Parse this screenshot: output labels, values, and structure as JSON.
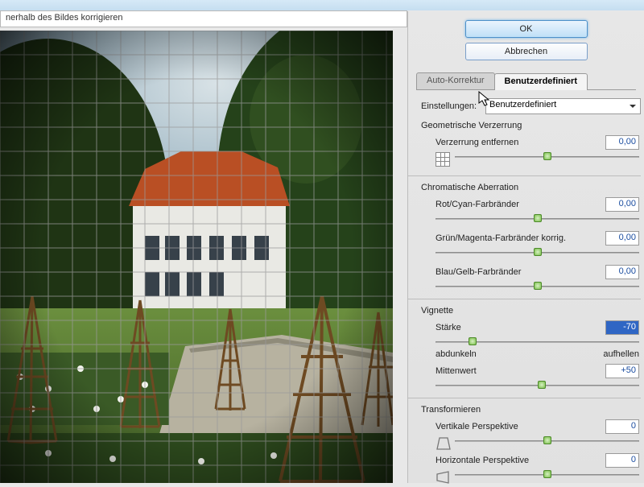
{
  "dialog": {
    "title_fragment": "nerhalb des Bildes korrigieren"
  },
  "buttons": {
    "ok": "OK",
    "cancel": "Abbrechen"
  },
  "tabs": {
    "auto": "Auto-Korrektur",
    "custom": "Benutzerdefiniert"
  },
  "settings": {
    "label": "Einstellungen:",
    "value": "Benutzerdefiniert"
  },
  "sections": {
    "distortion": {
      "title": "Geometrische Verzerrung",
      "remove": {
        "label": "Verzerrung entfernen",
        "value": "0,00",
        "pos": 50
      }
    },
    "chroma": {
      "title": "Chromatische Aberration",
      "red": {
        "label": "Rot/Cyan-Farbränder",
        "value": "0,00",
        "pos": 50
      },
      "green": {
        "label": "Grün/Magenta-Farbränder korrig.",
        "value": "0,00",
        "pos": 50
      },
      "blue": {
        "label": "Blau/Gelb-Farbränder",
        "value": "0,00",
        "pos": 50
      }
    },
    "vignette": {
      "title": "Vignette",
      "amount": {
        "label": "Stärke",
        "value": "-70",
        "pos": 18,
        "left": "abdunkeln",
        "right": "aufhellen"
      },
      "mid": {
        "label": "Mittenwert",
        "value": "+50",
        "pos": 52
      }
    },
    "transform": {
      "title": "Transformieren",
      "vpersp": {
        "label": "Vertikale Perspektive",
        "value": "0",
        "pos": 50
      },
      "hpersp": {
        "label": "Horizontale Perspektive",
        "value": "0",
        "pos": 50
      }
    }
  }
}
